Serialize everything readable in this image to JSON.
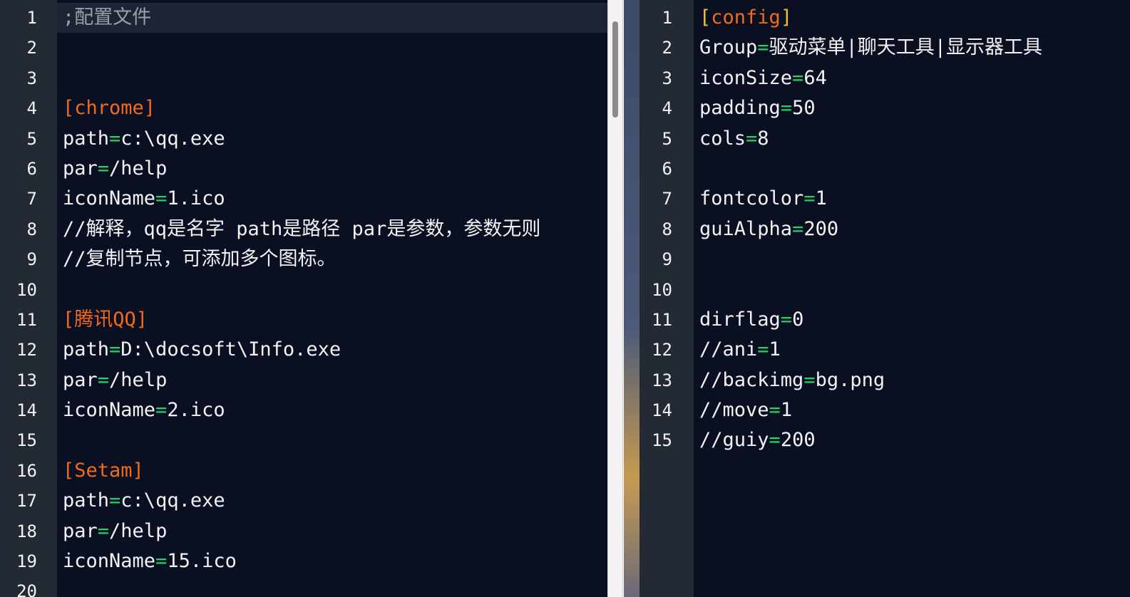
{
  "left_editor": {
    "lines": [
      {
        "n": "1",
        "tokens": [
          {
            "t": ";配置文件",
            "k": "comment"
          }
        ],
        "current": true
      },
      {
        "n": "2",
        "tokens": []
      },
      {
        "n": "3",
        "tokens": []
      },
      {
        "n": "4",
        "tokens": [
          {
            "t": "[chrome]",
            "k": "section"
          }
        ]
      },
      {
        "n": "5",
        "tokens": [
          {
            "t": "path",
            "k": "key"
          },
          {
            "t": "=",
            "k": "eq"
          },
          {
            "t": "c:\\qq.exe",
            "k": "val"
          }
        ]
      },
      {
        "n": "6",
        "tokens": [
          {
            "t": "par",
            "k": "key"
          },
          {
            "t": "=",
            "k": "eq"
          },
          {
            "t": "/help",
            "k": "val"
          }
        ]
      },
      {
        "n": "7",
        "tokens": [
          {
            "t": "iconName",
            "k": "key"
          },
          {
            "t": "=",
            "k": "eq"
          },
          {
            "t": "1.ico",
            "k": "val"
          }
        ]
      },
      {
        "n": "8",
        "tokens": [
          {
            "t": "//解释，qq是名字 path是路径 par是参数，参数无则",
            "k": "text"
          }
        ]
      },
      {
        "n": "9",
        "tokens": [
          {
            "t": "//复制节点，可添加多个图标。",
            "k": "text"
          }
        ]
      },
      {
        "n": "10",
        "tokens": []
      },
      {
        "n": "11",
        "tokens": [
          {
            "t": "[腾讯QQ]",
            "k": "section"
          }
        ]
      },
      {
        "n": "12",
        "tokens": [
          {
            "t": "path",
            "k": "key"
          },
          {
            "t": "=",
            "k": "eq"
          },
          {
            "t": "D:\\docsoft\\Info.exe",
            "k": "val"
          }
        ]
      },
      {
        "n": "13",
        "tokens": [
          {
            "t": "par",
            "k": "key"
          },
          {
            "t": "=",
            "k": "eq"
          },
          {
            "t": "/help",
            "k": "val"
          }
        ]
      },
      {
        "n": "14",
        "tokens": [
          {
            "t": "iconName",
            "k": "key"
          },
          {
            "t": "=",
            "k": "eq"
          },
          {
            "t": "2.ico",
            "k": "val"
          }
        ]
      },
      {
        "n": "15",
        "tokens": []
      },
      {
        "n": "16",
        "tokens": [
          {
            "t": "[Setam]",
            "k": "section"
          }
        ]
      },
      {
        "n": "17",
        "tokens": [
          {
            "t": "path",
            "k": "key"
          },
          {
            "t": "=",
            "k": "eq"
          },
          {
            "t": "c:\\qq.exe",
            "k": "val"
          }
        ]
      },
      {
        "n": "18",
        "tokens": [
          {
            "t": "par",
            "k": "key"
          },
          {
            "t": "=",
            "k": "eq"
          },
          {
            "t": "/help",
            "k": "val"
          }
        ]
      },
      {
        "n": "19",
        "tokens": [
          {
            "t": "iconName",
            "k": "key"
          },
          {
            "t": "=",
            "k": "eq"
          },
          {
            "t": "15.ico",
            "k": "val"
          }
        ]
      },
      {
        "n": "20",
        "tokens": []
      }
    ]
  },
  "right_editor": {
    "lines": [
      {
        "n": "1",
        "tokens": [
          {
            "t": "[",
            "k": "bracket"
          },
          {
            "t": "config",
            "k": "section"
          },
          {
            "t": "]",
            "k": "bracket"
          }
        ]
      },
      {
        "n": "2",
        "tokens": [
          {
            "t": "Group",
            "k": "key"
          },
          {
            "t": "=",
            "k": "eq"
          },
          {
            "t": "驱动菜单|聊天工具|显示器工具",
            "k": "val"
          }
        ]
      },
      {
        "n": "3",
        "tokens": [
          {
            "t": "iconSize",
            "k": "key"
          },
          {
            "t": "=",
            "k": "eq"
          },
          {
            "t": "64",
            "k": "val"
          }
        ]
      },
      {
        "n": "4",
        "tokens": [
          {
            "t": "padding",
            "k": "key"
          },
          {
            "t": "=",
            "k": "eq"
          },
          {
            "t": "50",
            "k": "val"
          }
        ]
      },
      {
        "n": "5",
        "tokens": [
          {
            "t": "cols",
            "k": "key"
          },
          {
            "t": "=",
            "k": "eq"
          },
          {
            "t": "8",
            "k": "val"
          }
        ]
      },
      {
        "n": "6",
        "tokens": []
      },
      {
        "n": "7",
        "tokens": [
          {
            "t": "fontcolor",
            "k": "key"
          },
          {
            "t": "=",
            "k": "eq"
          },
          {
            "t": "1",
            "k": "val"
          }
        ]
      },
      {
        "n": "8",
        "tokens": [
          {
            "t": "guiAlpha",
            "k": "key"
          },
          {
            "t": "=",
            "k": "eq"
          },
          {
            "t": "200",
            "k": "val"
          }
        ]
      },
      {
        "n": "9",
        "tokens": []
      },
      {
        "n": "10",
        "tokens": []
      },
      {
        "n": "11",
        "tokens": [
          {
            "t": "dirflag",
            "k": "key"
          },
          {
            "t": "=",
            "k": "eq"
          },
          {
            "t": "0",
            "k": "val"
          }
        ]
      },
      {
        "n": "12",
        "tokens": [
          {
            "t": "//ani",
            "k": "key"
          },
          {
            "t": "=",
            "k": "eq"
          },
          {
            "t": "1",
            "k": "val"
          }
        ]
      },
      {
        "n": "13",
        "tokens": [
          {
            "t": "//backimg",
            "k": "key"
          },
          {
            "t": "=",
            "k": "eq"
          },
          {
            "t": "bg.png",
            "k": "val"
          }
        ]
      },
      {
        "n": "14",
        "tokens": [
          {
            "t": "//move",
            "k": "key"
          },
          {
            "t": "=",
            "k": "eq"
          },
          {
            "t": "1",
            "k": "val"
          }
        ]
      },
      {
        "n": "15",
        "tokens": [
          {
            "t": "//guiy",
            "k": "key"
          },
          {
            "t": "=",
            "k": "eq"
          },
          {
            "t": "200",
            "k": "val"
          }
        ]
      }
    ]
  },
  "colors": {
    "editor_bg": "#0b0f22",
    "gutter_bg": "#232a33",
    "text": "#f2f2f2",
    "section": "#f26a1b",
    "bracket": "#f2c029",
    "equals": "#27d06a",
    "comment": "#9aa0a6"
  }
}
